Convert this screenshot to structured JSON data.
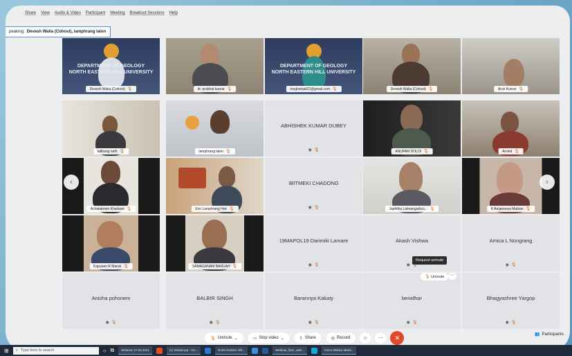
{
  "menu": [
    "Share",
    "View",
    "Audio & Video",
    "Participant",
    "Meeting",
    "Breakout Sessions",
    "Help"
  ],
  "speaking": {
    "label": "peaking:",
    "name": "Devesh Walia (Cohost), lamphrang lalon"
  },
  "tiles": [
    {
      "name": "Devesh Walia (Cohost)",
      "type": "video"
    },
    {
      "name": "dr. prabhat kumar",
      "type": "video"
    },
    {
      "name": "meghanjali22@gmail.com",
      "type": "video"
    },
    {
      "name": "Devesh Walia (Cohost)",
      "type": "video"
    },
    {
      "name": "Arun Kumar",
      "type": "video"
    },
    {
      "name": "lalthang nath",
      "type": "video"
    },
    {
      "name": "lamphrang lalon",
      "type": "video"
    },
    {
      "name": "ABHISHEK KUMAR DUBEY",
      "type": "text"
    },
    {
      "name": "ANUPAM DOLOI",
      "type": "video"
    },
    {
      "name": "Arvind",
      "type": "video"
    },
    {
      "name": "Achalakmen Kharbani",
      "type": "video"
    },
    {
      "name": "Eric Lamphrang Hek",
      "type": "video"
    },
    {
      "name": "IBITMEKI CHADONG",
      "type": "text"
    },
    {
      "name": "Japhilha Lalmangaihzu...",
      "type": "video"
    },
    {
      "name": "K Amjanessa Mabian",
      "type": "video"
    },
    {
      "name": "Kapuiam R Marak",
      "type": "video"
    },
    {
      "name": "SAMAGANAM BARUAH",
      "type": "video"
    },
    {
      "name": "19MAPOL19 Darimiki Lamare",
      "type": "text"
    },
    {
      "name": "Akash Vishwa",
      "type": "text"
    },
    {
      "name": "Amica L Nongrang",
      "type": "text"
    },
    {
      "name": "Anisha pohsnem",
      "type": "text"
    },
    {
      "name": "BALBIR SINGH",
      "type": "text"
    },
    {
      "name": "Barannya Kakaty",
      "type": "text"
    },
    {
      "name": "benidhar",
      "type": "text"
    },
    {
      "name": "Bhagyashree Yargop",
      "type": "text"
    }
  ],
  "banner": {
    "left": "DEPARTMENT OF GEOLOGY\nNORTH EASTERN HILL UNIVERSITY",
    "right": "DEPARTMENT OF GEOLOGY\nNORTH EASTERN HILL UNIVERSITY"
  },
  "tooltip": "Request unmute",
  "unmute_chip": "Unmute",
  "toolbar": {
    "unmute": "Unmute",
    "stop_video": "Stop video",
    "share": "Share",
    "record": "Record"
  },
  "participants_label": "Participants",
  "taskbar": {
    "search": "Type here to search",
    "items": [
      "Webinar 27.03.2021",
      "(1) WhatsApp - Go...",
      "North Eastern Hill...",
      "Webinar_flyer_with...",
      "Cisco Webex Meeti..."
    ]
  },
  "colors": {
    "accent": "#4a90d9",
    "end_call": "#e04a2a",
    "mic_muted": "#d2691e"
  }
}
